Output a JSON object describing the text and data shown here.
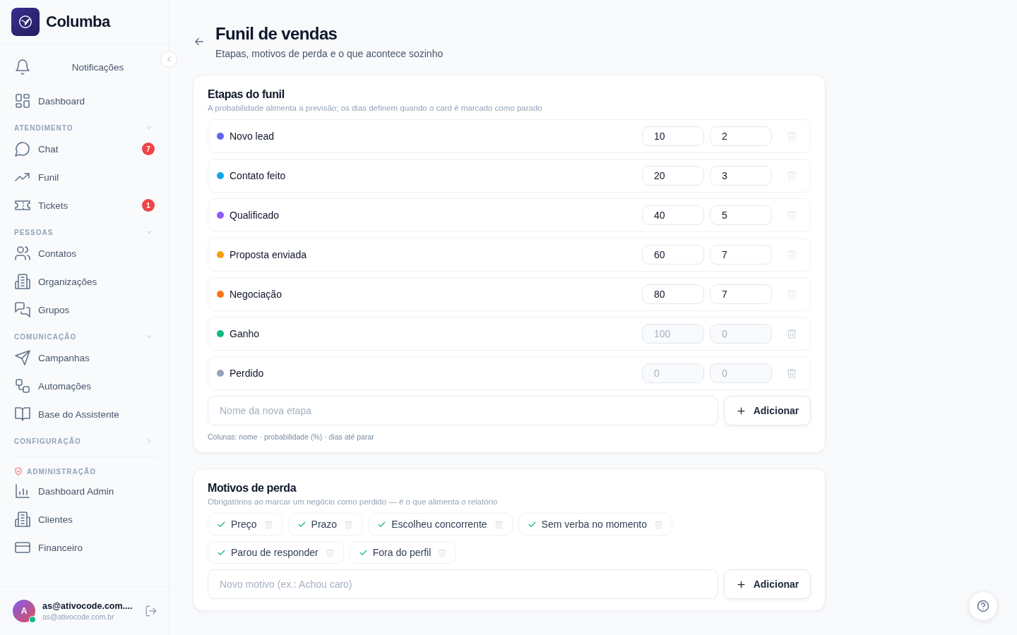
{
  "sidebar": {
    "brand": "Columba",
    "nav": [
      {
        "kind": "notifications",
        "label": "Notificações"
      },
      {
        "kind": "link",
        "label": "Dashboard"
      },
      {
        "kind": "section",
        "label": "ATENDIMENTO",
        "expanded": true
      },
      {
        "kind": "link",
        "label": "Chat",
        "badge": "7"
      },
      {
        "kind": "link",
        "label": "Funil"
      },
      {
        "kind": "link",
        "label": "Tickets",
        "badge": "1"
      },
      {
        "kind": "section",
        "label": "PESSOAS",
        "expanded": true
      },
      {
        "kind": "link",
        "label": "Contatos"
      },
      {
        "kind": "link",
        "label": "Organizações"
      },
      {
        "kind": "link",
        "label": "Grupos"
      },
      {
        "kind": "section",
        "label": "COMUNICAÇÃO",
        "expanded": true
      },
      {
        "kind": "link",
        "label": "Campanhas"
      },
      {
        "kind": "link",
        "label": "Automações"
      },
      {
        "kind": "link",
        "label": "Base do Assistente"
      },
      {
        "kind": "section",
        "label": "CONFIGURAÇÃO",
        "expanded": false
      },
      {
        "kind": "admin",
        "label": "ADMINISTRAÇÃO"
      },
      {
        "kind": "link",
        "label": "Dashboard Admin"
      },
      {
        "kind": "link",
        "label": "Clientes"
      },
      {
        "kind": "link",
        "label": "Financeiro"
      }
    ],
    "user": {
      "initial": "A",
      "name": "as@ativocode.com....",
      "email": "as@ativocode.com.br",
      "online": true
    }
  },
  "page": {
    "title": "Funil de vendas",
    "subtitle": "Etapas, motivos de perda e o que acontece sozinho"
  },
  "stages_card": {
    "title": "Etapas do funil",
    "subtitle": "A probabilidade alimenta a previsão; os dias definem quando o card é marcado como parado",
    "stages": [
      {
        "name": "Novo lead",
        "color": "#6366f1",
        "probability": "10",
        "days": "2",
        "locked": false
      },
      {
        "name": "Contato feito",
        "color": "#0ea5e9",
        "probability": "20",
        "days": "3",
        "locked": false
      },
      {
        "name": "Qualificado",
        "color": "#8b5cf6",
        "probability": "40",
        "days": "5",
        "locked": false
      },
      {
        "name": "Proposta enviada",
        "color": "#f59e0b",
        "probability": "60",
        "days": "7",
        "locked": false
      },
      {
        "name": "Negociação",
        "color": "#f97316",
        "probability": "80",
        "days": "7",
        "locked": false
      },
      {
        "name": "Ganho",
        "color": "#10b981",
        "probability": "100",
        "days": "0",
        "locked": true
      },
      {
        "name": "Perdido",
        "color": "#94a3b8",
        "probability": "0",
        "days": "0",
        "locked": true
      }
    ],
    "new_placeholder": "Nome da nova etapa",
    "add_button": "Adicionar",
    "footnote": "Colunas: nome · probabilidade (%) · dias até parar"
  },
  "reasons_card": {
    "title": "Motivos de perda",
    "subtitle": "Obrigatórios ao marcar um negócio como perdido — é o que alimenta o relatório",
    "reasons": [
      "Preço",
      "Prazo",
      "Escolheu concorrente",
      "Sem verba no momento",
      "Parou de responder",
      "Fora do perfil"
    ],
    "new_placeholder": "Novo motivo (ex.: Achou caro)",
    "add_button": "Adicionar"
  }
}
